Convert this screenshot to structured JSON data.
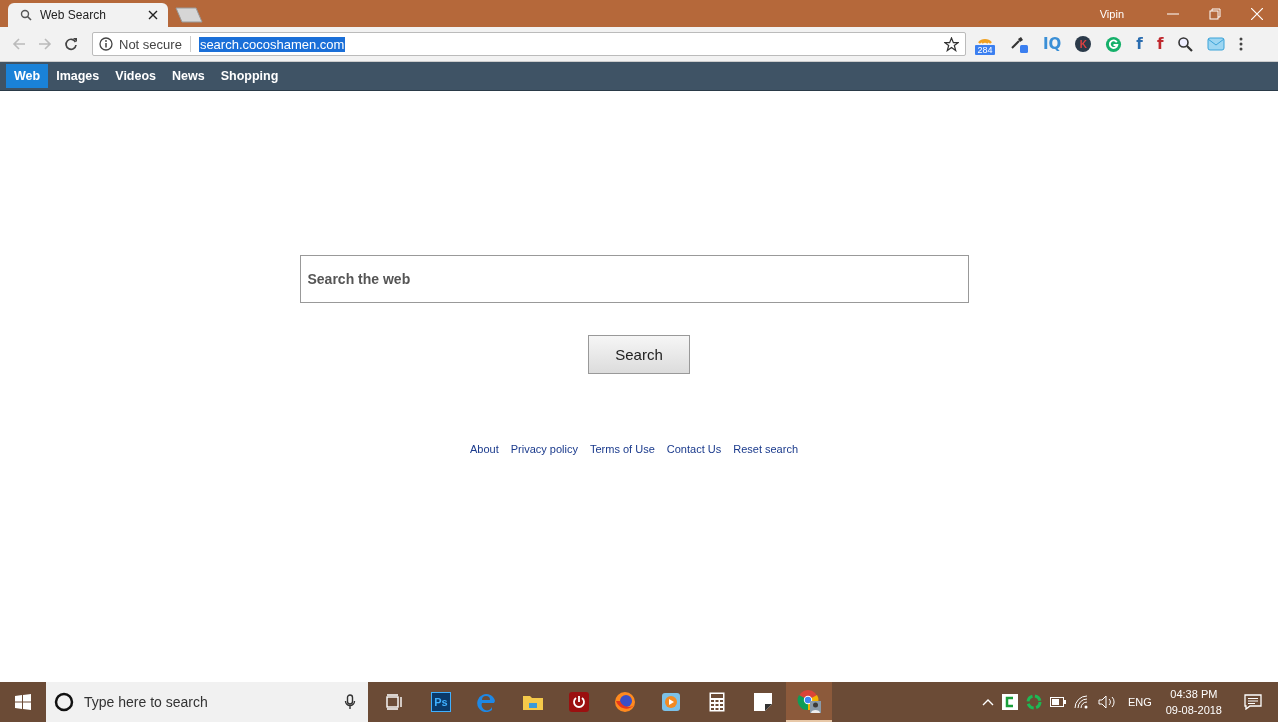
{
  "window": {
    "user": "Vipin"
  },
  "tabs": [
    {
      "title": "Web Search",
      "selected": true
    }
  ],
  "address_bar": {
    "security": "Not secure",
    "url": "search.cocoshamen.com",
    "url_selected": true
  },
  "extensions": [
    {
      "kind": "rss",
      "badge": "284"
    },
    {
      "kind": "picker"
    },
    {
      "kind": "text",
      "glyph": "IQ",
      "color": "#3a8fd6"
    },
    {
      "kind": "circle",
      "glyph": "K",
      "color": "#2b3a4a"
    },
    {
      "kind": "ring",
      "color": "#15b06a"
    },
    {
      "kind": "text",
      "glyph": "f",
      "color": "#2a6db0"
    },
    {
      "kind": "text",
      "glyph": "f",
      "color": "#c0282d"
    },
    {
      "kind": "magnifier"
    },
    {
      "kind": "mail"
    }
  ],
  "nav": [
    {
      "label": "Web",
      "selected": true
    },
    {
      "label": "Images",
      "selected": false
    },
    {
      "label": "Videos",
      "selected": false
    },
    {
      "label": "News",
      "selected": false
    },
    {
      "label": "Shopping",
      "selected": false
    }
  ],
  "search": {
    "placeholder": "Search the web",
    "button": "Search"
  },
  "footer_links": [
    "About",
    "Privacy policy",
    "Terms of Use",
    "Contact Us",
    "Reset search"
  ],
  "taskbar": {
    "search_placeholder": "Type here to search",
    "apps": [
      {
        "kind": "taskview",
        "active": false
      },
      {
        "kind": "photoshop",
        "glyph": "Ps",
        "active": false
      },
      {
        "kind": "edge",
        "active": false
      },
      {
        "kind": "explorer",
        "active": false
      },
      {
        "kind": "power",
        "active": false
      },
      {
        "kind": "firefox",
        "active": false
      },
      {
        "kind": "player",
        "active": false
      },
      {
        "kind": "calculator",
        "active": false
      },
      {
        "kind": "notes",
        "active": false
      },
      {
        "kind": "chrome",
        "active": true
      }
    ],
    "language": "ENG",
    "time": "04:38 PM",
    "date": "09-08-2018"
  }
}
